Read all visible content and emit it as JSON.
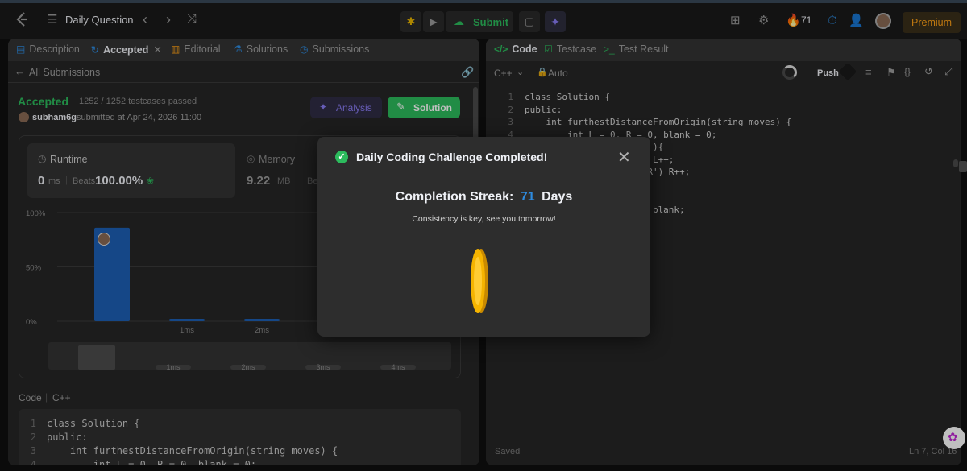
{
  "topbar": {
    "daily_question": "Daily Question",
    "submit_label": "Submit",
    "streak_count": "71",
    "premium_label": "Premium"
  },
  "left_tabs": {
    "description": "Description",
    "accepted": "Accepted",
    "editorial": "Editorial",
    "solutions": "Solutions",
    "submissions": "Submissions"
  },
  "submission": {
    "back_label": "All Submissions",
    "status": "Accepted",
    "testcases": "1252 / 1252 testcases passed",
    "user": "subham6g",
    "submitted_at": "submitted at Apr 24, 2026 11:00",
    "analysis_label": "Analysis",
    "solution_label": "Solution",
    "runtime_label": "Runtime",
    "runtime_value": "0",
    "runtime_unit": "ms",
    "beats_label": "Beats",
    "runtime_beats": "100.00%",
    "memory_label": "Memory",
    "memory_value": "9.22",
    "memory_unit": "MB",
    "memory_beats_partial": "Be"
  },
  "chart_data": {
    "type": "bar",
    "y_ticks": [
      "100%",
      "50%",
      "0%"
    ],
    "categories": [
      "0ms",
      "1ms",
      "2ms",
      "3ms"
    ],
    "x_tick_labels": [
      "1ms",
      "2ms"
    ],
    "values": [
      86,
      2,
      2,
      2
    ],
    "ylim": [
      0,
      100
    ],
    "minimap_labels": [
      "1ms",
      "2ms",
      "3ms",
      "4ms"
    ]
  },
  "code_section": {
    "code_label": "Code",
    "lang_label": "C++",
    "lines": [
      "class Solution {",
      "public:",
      "    int furthestDistanceFromOrigin(string moves) {",
      "        int L = 0, R = 0, blank = 0;"
    ]
  },
  "right_tabs": {
    "code": "Code",
    "testcase": "Testcase",
    "test_result": "Test Result"
  },
  "editor": {
    "language": "C++",
    "auto_label": "Auto",
    "push_label": "Push",
    "saved_label": "Saved",
    "cursor_pos": "Ln 7, Col 16",
    "lines": [
      "class Solution {",
      "public:",
      "    int furthestDistanceFromOrigin(string moves) {",
      "        int L = 0, R = 0, blank = 0;",
      "                        ){",
      "                        L++;",
      "                      'R') R++;",
      "",
      "",
      "                        blank;"
    ]
  },
  "modal": {
    "title": "Daily Coding Challenge Completed!",
    "streak_label": "Completion Streak:",
    "streak_number": "71",
    "streak_days": "Days",
    "message": "Consistency is key, see you tomorrow!"
  },
  "colors": {
    "accent_green": "#2cbb5d",
    "accent_blue": "#2e8bdf",
    "coin_gold": "#f5b400",
    "bar_blue": "#1d5fb4",
    "premium_orange": "#ffa116"
  }
}
